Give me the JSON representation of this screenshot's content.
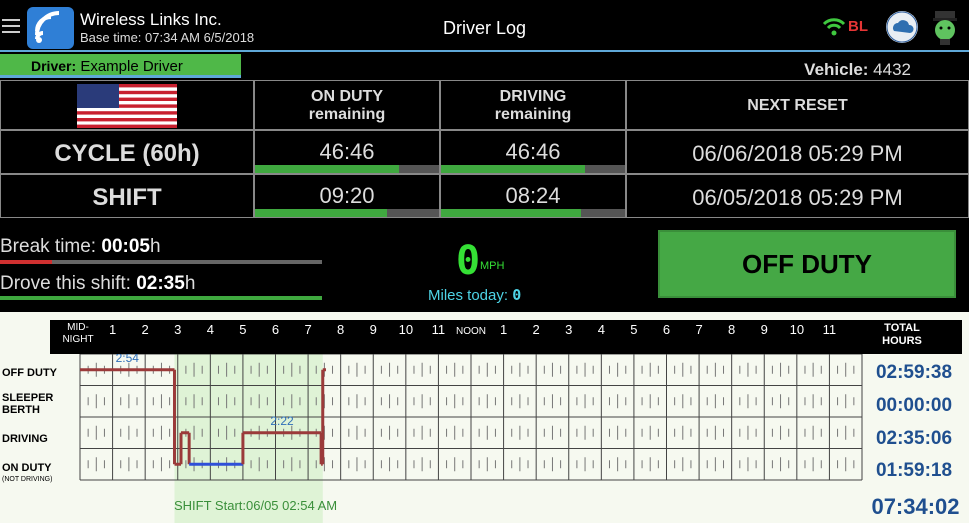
{
  "header": {
    "company": "Wireless Links Inc.",
    "base_time": "Base time: 07:34 AM 6/5/2018",
    "title": "Driver Log",
    "bluetooth_label": "BL",
    "icons": [
      "menu-icon",
      "wifi-logo-icon",
      "wifi-signal-icon",
      "cloud-sync-icon",
      "driver-avatar-icon"
    ]
  },
  "driver_bar": {
    "driver_label": "Driver:",
    "driver_name": "Example Driver",
    "vehicle_label": "Vehicle:",
    "vehicle_number": "4432"
  },
  "hos_table": {
    "col_headers": {
      "on_duty": [
        "ON DUTY",
        "remaining"
      ],
      "driving": [
        "DRIVING",
        "remaining"
      ],
      "next_reset": "NEXT RESET"
    },
    "rows": [
      {
        "label": "CYCLE (60h)",
        "on_duty": "46:46",
        "on_duty_fraction": 0.78,
        "driving": "46:46",
        "driving_fraction": 0.78,
        "next_reset": "06/06/2018 05:29 PM"
      },
      {
        "label": "SHIFT",
        "on_duty": "09:20",
        "on_duty_fraction": 0.72,
        "driving": "08:24",
        "driving_fraction": 0.76,
        "next_reset": "06/05/2018 05:29 PM"
      }
    ],
    "colors": {
      "bar_fill": "#3fa83f",
      "bar_bg": "#555555"
    }
  },
  "status": {
    "break_label": "Break time: ",
    "break_value": "00:05",
    "break_unit": "h",
    "break_fraction": 0.16,
    "drove_label": "Drove this shift: ",
    "drove_value": "02:35",
    "drove_unit": "h",
    "drove_fraction": 1.0,
    "speed": "0",
    "speed_unit": "MPH",
    "miles_label": "Miles today: ",
    "miles_value": "0",
    "duty_button": "OFF DUTY"
  },
  "log_graph": {
    "hour_labels": [
      "MID-NIGHT",
      "1",
      "2",
      "3",
      "4",
      "5",
      "6",
      "7",
      "8",
      "9",
      "10",
      "11",
      "NOON",
      "1",
      "2",
      "3",
      "4",
      "5",
      "6",
      "7",
      "8",
      "9",
      "10",
      "11"
    ],
    "total_header": [
      "TOTAL",
      "HOURS"
    ],
    "rows": [
      {
        "label": "OFF DUTY",
        "sub": "",
        "total": "02:59:38"
      },
      {
        "label": "SLEEPER",
        "sub": "BERTH",
        "total": "00:00:00"
      },
      {
        "label": "DRIVING",
        "sub": "",
        "total": "02:35:06"
      },
      {
        "label": "ON DUTY",
        "sub": "(NOT DRIVING)",
        "total": "01:59:18"
      }
    ],
    "grand_total": "07:34:02",
    "annotations": [
      "2:54",
      "2:22"
    ],
    "shift_start": "SHIFT Start:06/05 02:54 AM",
    "segments": [
      {
        "status": 0,
        "start": 0.0,
        "end": 2.9
      },
      {
        "status": 3,
        "start": 2.9,
        "end": 3.1
      },
      {
        "status": 2,
        "start": 3.1,
        "end": 3.35
      },
      {
        "status": 3,
        "start": 3.35,
        "end": 5.0
      },
      {
        "status": 2,
        "start": 5.0,
        "end": 7.4
      },
      {
        "status": 3,
        "start": 7.4,
        "end": 7.45
      },
      {
        "status": 0,
        "start": 7.45,
        "end": 7.55
      }
    ],
    "colors": {
      "line": "#9b3a3a",
      "on_duty_line": "#2f4fd8",
      "shift_shade": "#dff3d6",
      "annotation": "#2f6fb8"
    }
  }
}
